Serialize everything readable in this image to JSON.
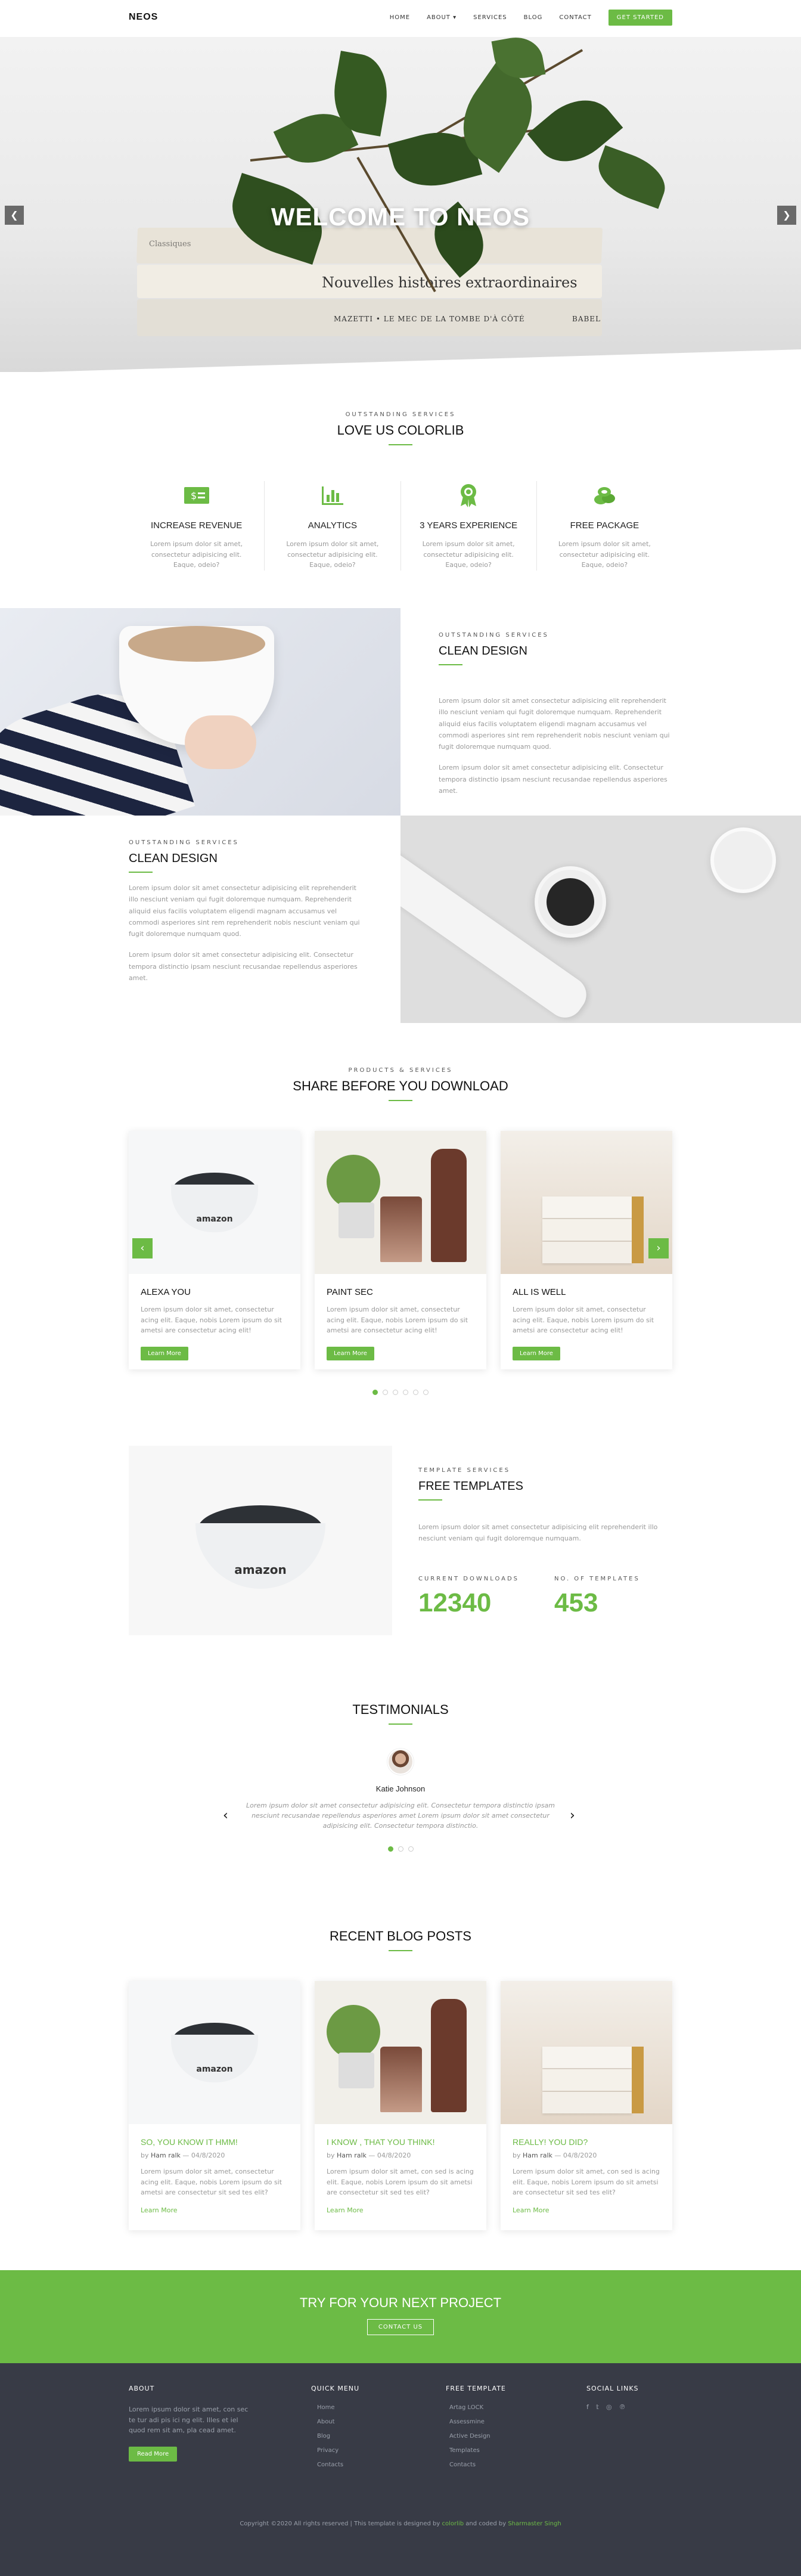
{
  "header": {
    "logo": "NEOS",
    "nav": [
      "HOME",
      "ABOUT ▾",
      "SERVICES",
      "BLOG",
      "CONTACT"
    ],
    "cta": "GET STARTED"
  },
  "hero": {
    "title": "WELCOME TO NEOS",
    "book_text_1": "Nouvelles histoires extraordinaires",
    "book_text_2": "MAZETTI • LE MEC DE LA TOMBE D'À CÔTÉ",
    "book_text_3": "BABEL",
    "book_text_4": "Classiques"
  },
  "services": {
    "kicker": "OUTSTANDING SERVICES",
    "title": "LOVE US COLORLIB",
    "items": [
      {
        "icon": "money-icon",
        "title": "INCREASE REVENUE",
        "text": "Lorem ipsum dolor sit amet, consectetur adipisicing elit. Eaque, odeio?"
      },
      {
        "icon": "bar-chart-icon",
        "title": "ANALYTICS",
        "text": "Lorem ipsum dolor sit amet, consectetur adipisicing elit. Eaque, odeio?"
      },
      {
        "icon": "award-icon",
        "title": "3 YEARS EXPERIENCE",
        "text": "Lorem ipsum dolor sit amet, consectetur adipisicing elit. Eaque, odeio?"
      },
      {
        "icon": "coins-icon",
        "title": "FREE PACKAGE",
        "text": "Lorem ipsum dolor sit amet, consectetur adipisicing elit. Eaque, odeio?"
      }
    ]
  },
  "feature1": {
    "kicker": "OUTSTANDING SERVICES",
    "title": "CLEAN DESIGN",
    "p1": "Lorem ipsum dolor sit amet consectetur adipisicing elit reprehenderit illo nesciunt veniam qui fugit doloremque numquam. Reprehenderit aliquid eius facilis voluptatem eligendi magnam accusamus vel commodi asperiores sint rem reprehenderit nobis nesciunt veniam qui fugit doloremque numquam quod.",
    "p2": "Lorem ipsum dolor sit amet consectetur adipisicing elit. Consectetur tempora distinctio ipsam nesciunt recusandae repellendus asperiores amet."
  },
  "feature2": {
    "kicker": "OUTSTANDING SERVICES",
    "title": "CLEAN DESIGN",
    "p1": "Lorem ipsum dolor sit amet consectetur adipisicing elit reprehenderit illo nesciunt veniam qui fugit doloremque numquam. Reprehenderit aliquid eius facilis voluptatem eligendi magnam accusamus vel commodi asperiores sint rem reprehenderit nobis nesciunt veniam qui fugit doloremque numquam quod.",
    "p2": "Lorem ipsum dolor sit amet consectetur adipisicing elit. Consectetur tempora distinctio ipsam nesciunt recusandae repellendus asperiores amet."
  },
  "products": {
    "kicker": "PRODUCTS & SERVICES",
    "title": "SHARE BEFORE YOU DOWNLOAD",
    "cards": [
      {
        "title": "ALEXA YOU",
        "text": "Lorem ipsum dolor sit amet, consectetur acing elit. Eaque, nobis Lorem ipsum do sit ametsi are consectetur acing elit!",
        "button": "Learn More"
      },
      {
        "title": "PAINT SEC",
        "text": "Lorem ipsum dolor sit amet, consectetur acing elit. Eaque, nobis Lorem ipsum do sit ametsi are consectetur acing elit!",
        "button": "Learn More"
      },
      {
        "title": "ALL IS WELL",
        "text": "Lorem ipsum dolor sit amet, consectetur acing elit. Eaque, nobis Lorem ipsum do sit ametsi are consectetur acing elit!",
        "button": "Learn More"
      }
    ],
    "echo_brand": "amazon"
  },
  "free": {
    "kicker": "TEMPLATE SERVICES",
    "title": "FREE TEMPLATES",
    "text": "Lorem ipsum dolor sit amet consectetur adipisicing elit reprehenderit illo nesciunt veniam qui fugit doloremque numquam.",
    "stat1_label": "CURRENT DOWNLOADS",
    "stat1_value": "12340",
    "stat2_label": "NO. OF TEMPLATES",
    "stat2_value": "453"
  },
  "testimonials": {
    "title": "TESTIMONIALS",
    "name": "Katie Johnson",
    "quote": "Lorem ipsum dolor sit amet consectetur adipisicing elit. Consectetur tempora distinctio ipsam nesciunt recusandae repellendus asperiores amet Lorem ipsum dolor sit amet consectetur adipisicing elit. Consectetur tempora distinctio."
  },
  "blog": {
    "title": "RECENT BLOG POSTS",
    "posts": [
      {
        "title": "SO, YOU KNOW IT HMM!",
        "by": "by",
        "author": "Ham ralk",
        "date": "— 04/8/2020",
        "text": "Lorem ipsum dolor sit amet, consectetur acing elit. Eaque, nobis Lorem ipsum do sit ametsi are consectetur sit sed tes elit?",
        "link": "Learn More"
      },
      {
        "title": "I KNOW , THAT YOU THINK!",
        "by": "by",
        "author": "Ham ralk",
        "date": "— 04/8/2020",
        "text": "Lorem ipsum dolor sit amet, con sed is acing elit. Eaque, nobis Lorem ipsum do sit ametsi are consectetur sit sed tes elit?",
        "link": "Learn More"
      },
      {
        "title": "REALLY! YOU DID?",
        "by": "by",
        "author": "Ham ralk",
        "date": "— 04/8/2020",
        "text": "Lorem ipsum dolor sit amet, con sed is acing elit. Eaque, nobis Lorem ipsum do sit ametsi are consectetur sit sed tes elit?",
        "link": "Learn More"
      }
    ]
  },
  "cta": {
    "title": "TRY FOR YOUR NEXT PROJECT",
    "button": "CONTACT US"
  },
  "footer": {
    "about_title": "ABOUT",
    "about_text": "Lorem ipsum dolor sit amet, con sec te tur adi pis ici ng elit. Illes et iel quod rem sit am, pla cead amet.",
    "about_button": "Read More",
    "quick_title": "QUICK MENU",
    "quick_links": [
      "Home",
      "About",
      "Blog",
      "Privacy",
      "Contacts"
    ],
    "free_title": "FREE TEMPLATE",
    "free_links": [
      "Artag LOCK",
      "Assessmine",
      "Active Design",
      "Templates",
      "Contacts"
    ],
    "social_title": "SOCIAL LINKS",
    "social_icons": [
      "facebook-icon",
      "twitter-icon",
      "instagram-icon",
      "pinterest-icon"
    ],
    "copy_pre": "Copyright ©2020 All rights reserved | This template is designed by",
    "copy_brand": "colorlib",
    "copy_mid": "and coded by",
    "copy_author": "Sharmaster Singh"
  },
  "colors": {
    "accent": "#6cbb45",
    "footer_bg": "#383b46"
  }
}
